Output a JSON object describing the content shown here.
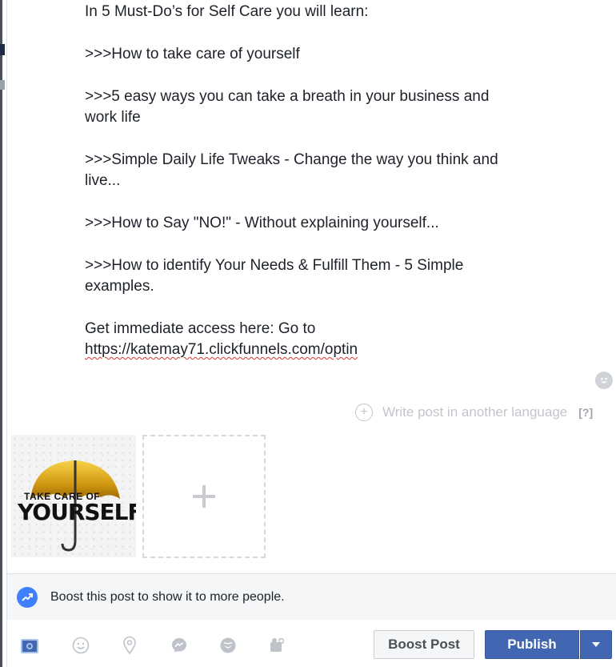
{
  "post": {
    "intro": "In 5 Must-Do’s for Self Care you will learn:",
    "item1": ">>>How to take care of yourself",
    "item2_line1": ">>>5 easy ways you can take a breath in your business and",
    "item2_line2": "work life",
    "item3_line1": ">>>Simple Daily Life Tweaks - Change the way you think and",
    "item3_line2": "live...",
    "item4": ">>>How to Say \"NO!\" - Without explaining yourself...",
    "item5_line1": ">>>How to identify Your Needs & Fulfill Them - 5 Simple",
    "item5_line2": "examples.",
    "cta_line1": "Get immediate access here: Go to",
    "cta_link": "https://katemay71.clickfunnels.com/optin"
  },
  "language": {
    "label": "Write post in another language",
    "help": "[?]"
  },
  "attachment": {
    "line1": "TAKE CARE OF",
    "line2": "YOURSELF"
  },
  "boost_bar": {
    "text": "Boost this post to show it to more people."
  },
  "actions": {
    "boost_post": "Boost Post",
    "publish": "Publish"
  },
  "toolbar_icons": [
    "photo-icon",
    "emoji-icon",
    "location-icon",
    "messenger-icon",
    "sticker-icon",
    "tag-icon"
  ],
  "colors": {
    "primary": "#4267b2",
    "boost_icon": "#4080ff",
    "muted": "#c2c6cc"
  }
}
